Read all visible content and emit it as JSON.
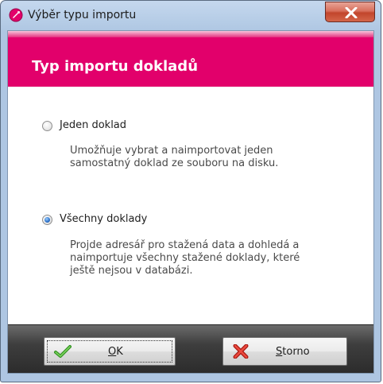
{
  "window": {
    "title": "Výběr typu importu",
    "close_symbol": "x"
  },
  "header": {
    "title": "Typ importu dokladů"
  },
  "options": [
    {
      "label": "Jeden doklad",
      "description_lines": [
        "Umožňuje vybrat a naimportovat jeden",
        "samostatný doklad ze souboru na disku."
      ],
      "checked": false
    },
    {
      "label": "Všechny doklady",
      "description_lines": [
        "Projde adresář pro stažená data a dohledá a",
        "naimportuje všechny stažené doklady, které",
        "ještě nejsou v databázi."
      ],
      "checked": true
    }
  ],
  "buttons": {
    "ok": {
      "mnemonic": "O",
      "rest": "K",
      "icon": "check-icon"
    },
    "cancel": {
      "mnemonic": "S",
      "rest": "torno",
      "icon": "cross-icon"
    }
  },
  "colors": {
    "accent": "#e2006b",
    "footer": "#3e3e3e",
    "check_green": "#3fae2a",
    "cross_red": "#d62c24"
  }
}
